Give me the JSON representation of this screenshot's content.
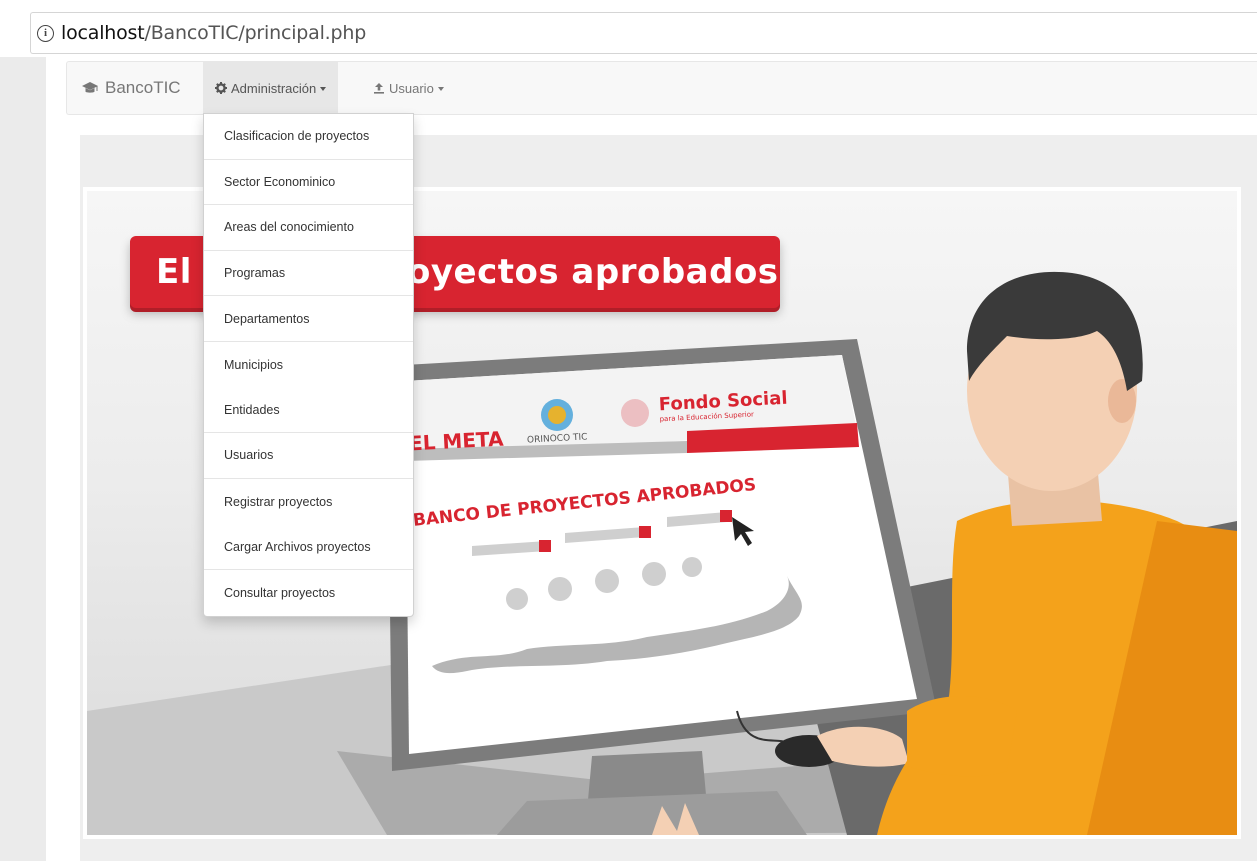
{
  "browser": {
    "url_host": "localhost",
    "url_path": "/BancoTIC/principal.php"
  },
  "navbar": {
    "brand": "BancoTIC",
    "brand_icon": "graduation-cap-icon",
    "menus": [
      {
        "label": "Administración",
        "icon": "gear-icon"
      },
      {
        "label": "Usuario",
        "icon": "upload-icon"
      }
    ]
  },
  "dropdown": {
    "items": [
      "Clasificacion de proyectos",
      "Sector Econominico",
      "Areas del conocimiento",
      "Programas",
      "Departamentos",
      "Municipios",
      "Entidades",
      "Usuarios",
      "Registrar proyectos",
      "Cargar Archivos proyectos",
      "Consultar proyectos"
    ]
  },
  "banner": {
    "title_start": "El",
    "title_end": "oyectos aprobados",
    "screen_logo_1": "EL META",
    "screen_logo_2": "ORINOCO TIC",
    "screen_logo_3": "Fondo Social",
    "screen_logo_3_sub": "para la Educación Superior",
    "screen_heading": "BANCO DE PROYECTOS APROBADOS"
  },
  "colors": {
    "red": "#d82430",
    "orange": "#f4a21b",
    "hair": "#3a3a3a",
    "skin": "#f4d0b4"
  }
}
